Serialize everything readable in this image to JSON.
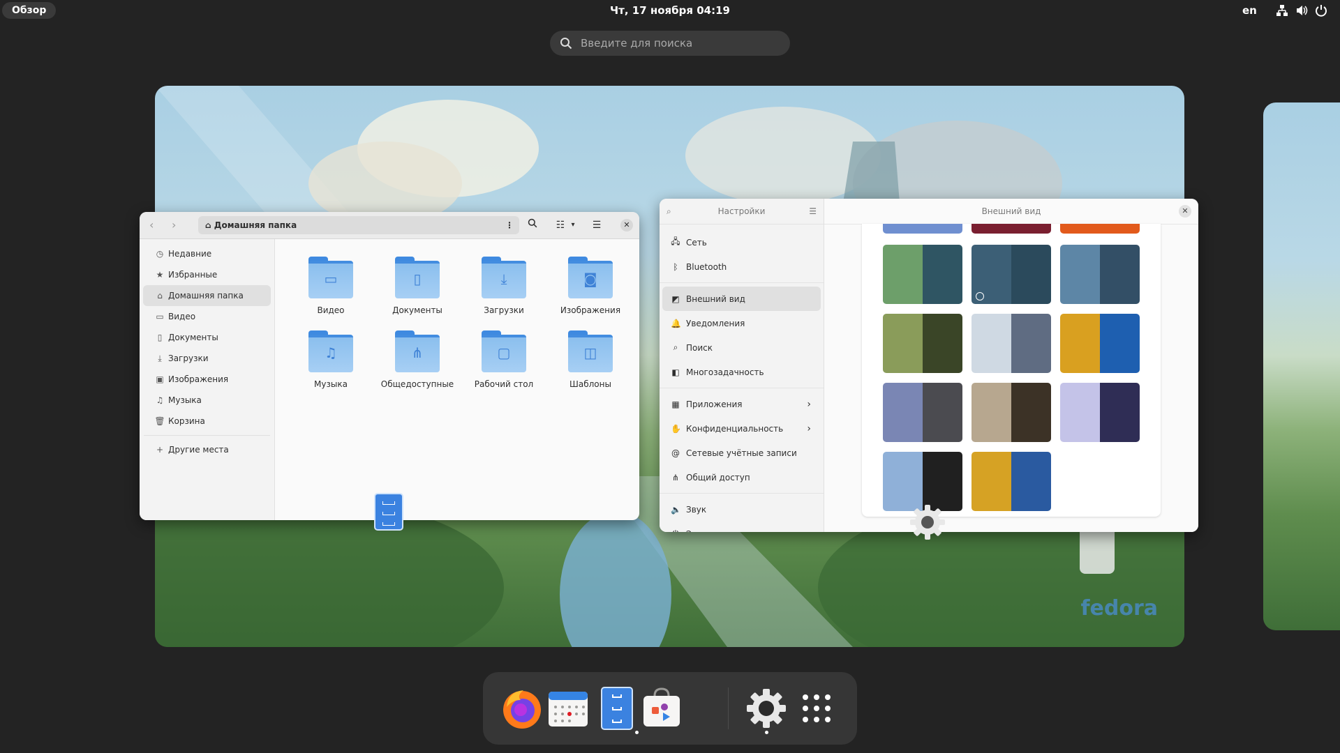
{
  "topbar": {
    "overview_label": "Обзор",
    "clock": "Чт, 17 ноября  04:19",
    "lang": "en",
    "icons": [
      "network-icon",
      "volume-icon",
      "power-icon"
    ]
  },
  "search": {
    "placeholder": "Введите для поиска"
  },
  "wallpaper": {
    "logo_text": "fedora"
  },
  "files": {
    "path": "Домашняя папка",
    "sidebar": [
      {
        "label": "Недавние",
        "icon": "clock-icon"
      },
      {
        "label": "Избранные",
        "icon": "star-icon"
      },
      {
        "label": "Домашняя папка",
        "icon": "home-icon",
        "selected": true
      },
      {
        "label": "Видео",
        "icon": "video-icon"
      },
      {
        "label": "Документы",
        "icon": "document-icon"
      },
      {
        "label": "Загрузки",
        "icon": "download-icon"
      },
      {
        "label": "Изображения",
        "icon": "image-icon"
      },
      {
        "label": "Музыка",
        "icon": "music-icon"
      },
      {
        "label": "Корзина",
        "icon": "trash-icon"
      }
    ],
    "other_places": "Другие места",
    "folders": [
      {
        "label": "Видео",
        "icon": "video-icon"
      },
      {
        "label": "Документы",
        "icon": "document-icon"
      },
      {
        "label": "Загрузки",
        "icon": "download-icon"
      },
      {
        "label": "Изображения",
        "icon": "camera-icon"
      },
      {
        "label": "Музыка",
        "icon": "music-icon"
      },
      {
        "label": "Общедоступные",
        "icon": "share-icon"
      },
      {
        "label": "Рабочий стол",
        "icon": "desktop-icon"
      },
      {
        "label": "Шаблоны",
        "icon": "template-icon"
      }
    ]
  },
  "settings": {
    "sidebar_title": "Настройки",
    "page_title": "Внешний вид",
    "groups": [
      [
        {
          "label": "Сеть",
          "icon": "network-icon"
        },
        {
          "label": "Bluetooth",
          "icon": "bluetooth-icon"
        }
      ],
      [
        {
          "label": "Внешний вид",
          "icon": "appearance-icon",
          "selected": true
        },
        {
          "label": "Уведомления",
          "icon": "bell-icon"
        },
        {
          "label": "Поиск",
          "icon": "search-icon"
        },
        {
          "label": "Многозадачность",
          "icon": "multitasking-icon"
        }
      ],
      [
        {
          "label": "Приложения",
          "icon": "apps-icon",
          "chevron": true
        },
        {
          "label": "Конфиденциальность",
          "icon": "hand-icon",
          "chevron": true
        },
        {
          "label": "Сетевые учётные записи",
          "icon": "at-icon"
        },
        {
          "label": "Общий доступ",
          "icon": "share-icon"
        }
      ],
      [
        {
          "label": "Звук",
          "icon": "speaker-icon"
        },
        {
          "label": "Электропитание",
          "icon": "power-icon"
        }
      ]
    ],
    "wallpapers": [
      {
        "left": "#6d9f6a",
        "right": "#2f5563",
        "selected": false
      },
      {
        "left": "#3c5f76",
        "right": "#2b4a5c",
        "selected": true
      },
      {
        "left": "#5d86a6",
        "right": "#334f66",
        "selected": false
      },
      {
        "left": "#8a9c5a",
        "right": "#3a4527",
        "selected": false
      },
      {
        "left": "#cfd9e3",
        "right": "#5f6c82",
        "selected": false
      },
      {
        "left": "#d9a020",
        "right": "#1e5fb0",
        "selected": false
      },
      {
        "left": "#7a86b4",
        "right": "#4b4b50",
        "selected": false
      },
      {
        "left": "#b7a78f",
        "right": "#3c3226",
        "selected": false
      },
      {
        "left": "#c4c3e8",
        "right": "#2f2d55",
        "selected": false
      },
      {
        "left": "#8fb0d8",
        "right": "#202020",
        "selected": false
      },
      {
        "left": "#d6a224",
        "right": "#2a5aa0",
        "selected": false
      }
    ],
    "wallpapers_top": [
      "#6f8fd0",
      "#7a1f30",
      "#e25a1c"
    ]
  },
  "dock": [
    {
      "name": "firefox",
      "running": false
    },
    {
      "name": "calendar",
      "running": false
    },
    {
      "name": "files",
      "running": true
    },
    {
      "name": "software",
      "running": false
    },
    {
      "name": "settings",
      "running": true
    },
    {
      "name": "app-grid",
      "running": false
    }
  ]
}
